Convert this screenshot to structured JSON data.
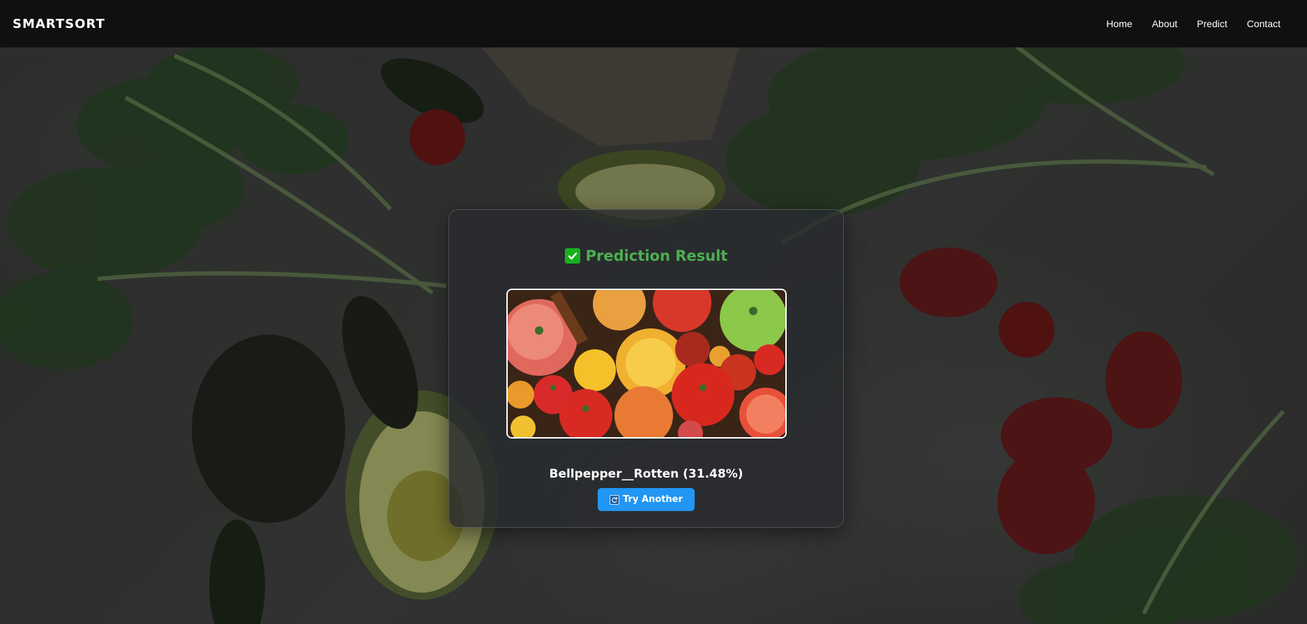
{
  "navbar": {
    "brand": "SMARTSORT",
    "links": [
      "Home",
      "About",
      "Predict",
      "Contact"
    ]
  },
  "result_card": {
    "title": "Prediction Result",
    "title_icon": "check-mark-icon",
    "image_subject": "tomatoes",
    "prediction": "Bellpepper__Rotten (31.48%)",
    "try_again_label": "Try Another",
    "try_again_icon": "refresh-icon"
  },
  "colors": {
    "navbar_bg": "#101010",
    "title_green": "#4caf50",
    "check_green": "#17b11f",
    "button_blue": "#2196f3"
  }
}
